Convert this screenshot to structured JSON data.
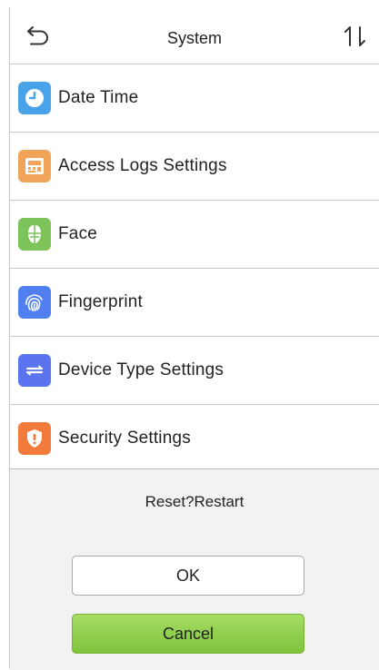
{
  "header": {
    "title": "System",
    "back_icon": "back-arrow-icon",
    "sort_icon": "sort-up-down-icon"
  },
  "menu": {
    "items": [
      {
        "label": "Date Time",
        "icon": "clock-icon",
        "color": "#4aa3e8"
      },
      {
        "label": "Access Logs Settings",
        "icon": "access-log-icon",
        "color": "#f0a45a"
      },
      {
        "label": "Face",
        "icon": "face-icon",
        "color": "#7cc35a"
      },
      {
        "label": "Fingerprint",
        "icon": "fingerprint-icon",
        "color": "#4f7ff0"
      },
      {
        "label": "Device Type Settings",
        "icon": "device-type-icon",
        "color": "#5a73ee"
      },
      {
        "label": "Security Settings",
        "icon": "shield-icon",
        "color": "#f27b3b"
      }
    ]
  },
  "dialog": {
    "message": "Reset?Restart",
    "ok_label": "OK",
    "cancel_label": "Cancel",
    "cancel_color": "#8ccf47"
  }
}
